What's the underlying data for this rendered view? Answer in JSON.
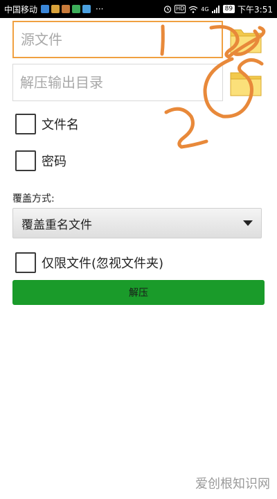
{
  "status_bar": {
    "carrier": "中国移动",
    "more": "···",
    "hd": "HD",
    "network": "4G",
    "battery": "89",
    "time": "下午3:51"
  },
  "form": {
    "source_placeholder": "源文件",
    "output_placeholder": "解压输出目录",
    "checkbox_filename": "文件名",
    "checkbox_password": "密码",
    "overwrite_label": "覆盖方式:",
    "overwrite_selected": "覆盖重名文件",
    "checkbox_files_only": "仅限文件(忽视文件夹)",
    "extract_button": "解压"
  },
  "watermark": "爱创根知识网",
  "colors": {
    "accent": "#1a9b2a",
    "focus_border": "#f0a040",
    "annotation": "#e8893a",
    "folder": "#fbe07a"
  }
}
